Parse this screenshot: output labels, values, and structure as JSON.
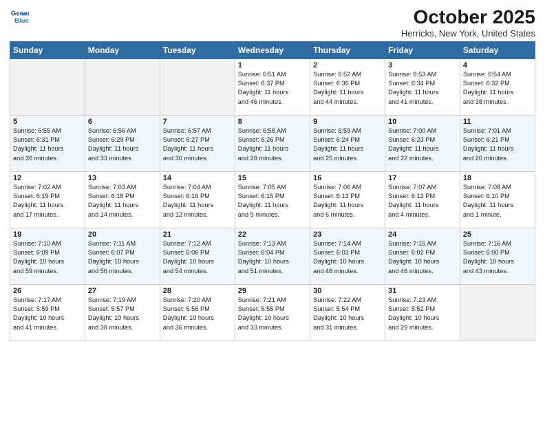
{
  "header": {
    "logo_line1": "General",
    "logo_line2": "Blue",
    "month": "October 2025",
    "location": "Herricks, New York, United States"
  },
  "days_of_week": [
    "Sunday",
    "Monday",
    "Tuesday",
    "Wednesday",
    "Thursday",
    "Friday",
    "Saturday"
  ],
  "weeks": [
    [
      {
        "day": "",
        "info": ""
      },
      {
        "day": "",
        "info": ""
      },
      {
        "day": "",
        "info": ""
      },
      {
        "day": "1",
        "info": "Sunrise: 6:51 AM\nSunset: 6:37 PM\nDaylight: 11 hours\nand 46 minutes."
      },
      {
        "day": "2",
        "info": "Sunrise: 6:52 AM\nSunset: 6:36 PM\nDaylight: 11 hours\nand 44 minutes."
      },
      {
        "day": "3",
        "info": "Sunrise: 6:53 AM\nSunset: 6:34 PM\nDaylight: 11 hours\nand 41 minutes."
      },
      {
        "day": "4",
        "info": "Sunrise: 6:54 AM\nSunset: 6:32 PM\nDaylight: 11 hours\nand 38 minutes."
      }
    ],
    [
      {
        "day": "5",
        "info": "Sunrise: 6:55 AM\nSunset: 6:31 PM\nDaylight: 11 hours\nand 36 minutes."
      },
      {
        "day": "6",
        "info": "Sunrise: 6:56 AM\nSunset: 6:29 PM\nDaylight: 11 hours\nand 33 minutes."
      },
      {
        "day": "7",
        "info": "Sunrise: 6:57 AM\nSunset: 6:27 PM\nDaylight: 11 hours\nand 30 minutes."
      },
      {
        "day": "8",
        "info": "Sunrise: 6:58 AM\nSunset: 6:26 PM\nDaylight: 11 hours\nand 28 minutes."
      },
      {
        "day": "9",
        "info": "Sunrise: 6:59 AM\nSunset: 6:24 PM\nDaylight: 11 hours\nand 25 minutes."
      },
      {
        "day": "10",
        "info": "Sunrise: 7:00 AM\nSunset: 6:23 PM\nDaylight: 11 hours\nand 22 minutes."
      },
      {
        "day": "11",
        "info": "Sunrise: 7:01 AM\nSunset: 6:21 PM\nDaylight: 11 hours\nand 20 minutes."
      }
    ],
    [
      {
        "day": "12",
        "info": "Sunrise: 7:02 AM\nSunset: 6:19 PM\nDaylight: 11 hours\nand 17 minutes."
      },
      {
        "day": "13",
        "info": "Sunrise: 7:03 AM\nSunset: 6:18 PM\nDaylight: 11 hours\nand 14 minutes."
      },
      {
        "day": "14",
        "info": "Sunrise: 7:04 AM\nSunset: 6:16 PM\nDaylight: 11 hours\nand 12 minutes."
      },
      {
        "day": "15",
        "info": "Sunrise: 7:05 AM\nSunset: 6:15 PM\nDaylight: 11 hours\nand 9 minutes."
      },
      {
        "day": "16",
        "info": "Sunrise: 7:06 AM\nSunset: 6:13 PM\nDaylight: 11 hours\nand 6 minutes."
      },
      {
        "day": "17",
        "info": "Sunrise: 7:07 AM\nSunset: 6:12 PM\nDaylight: 11 hours\nand 4 minutes."
      },
      {
        "day": "18",
        "info": "Sunrise: 7:08 AM\nSunset: 6:10 PM\nDaylight: 11 hours\nand 1 minute."
      }
    ],
    [
      {
        "day": "19",
        "info": "Sunrise: 7:10 AM\nSunset: 6:09 PM\nDaylight: 10 hours\nand 59 minutes."
      },
      {
        "day": "20",
        "info": "Sunrise: 7:11 AM\nSunset: 6:07 PM\nDaylight: 10 hours\nand 56 minutes."
      },
      {
        "day": "21",
        "info": "Sunrise: 7:12 AM\nSunset: 6:06 PM\nDaylight: 10 hours\nand 54 minutes."
      },
      {
        "day": "22",
        "info": "Sunrise: 7:13 AM\nSunset: 6:04 PM\nDaylight: 10 hours\nand 51 minutes."
      },
      {
        "day": "23",
        "info": "Sunrise: 7:14 AM\nSunset: 6:03 PM\nDaylight: 10 hours\nand 48 minutes."
      },
      {
        "day": "24",
        "info": "Sunrise: 7:15 AM\nSunset: 6:02 PM\nDaylight: 10 hours\nand 46 minutes."
      },
      {
        "day": "25",
        "info": "Sunrise: 7:16 AM\nSunset: 6:00 PM\nDaylight: 10 hours\nand 43 minutes."
      }
    ],
    [
      {
        "day": "26",
        "info": "Sunrise: 7:17 AM\nSunset: 5:59 PM\nDaylight: 10 hours\nand 41 minutes."
      },
      {
        "day": "27",
        "info": "Sunrise: 7:19 AM\nSunset: 5:57 PM\nDaylight: 10 hours\nand 38 minutes."
      },
      {
        "day": "28",
        "info": "Sunrise: 7:20 AM\nSunset: 5:56 PM\nDaylight: 10 hours\nand 36 minutes."
      },
      {
        "day": "29",
        "info": "Sunrise: 7:21 AM\nSunset: 5:55 PM\nDaylight: 10 hours\nand 33 minutes."
      },
      {
        "day": "30",
        "info": "Sunrise: 7:22 AM\nSunset: 5:54 PM\nDaylight: 10 hours\nand 31 minutes."
      },
      {
        "day": "31",
        "info": "Sunrise: 7:23 AM\nSunset: 5:52 PM\nDaylight: 10 hours\nand 29 minutes."
      },
      {
        "day": "",
        "info": ""
      }
    ]
  ]
}
